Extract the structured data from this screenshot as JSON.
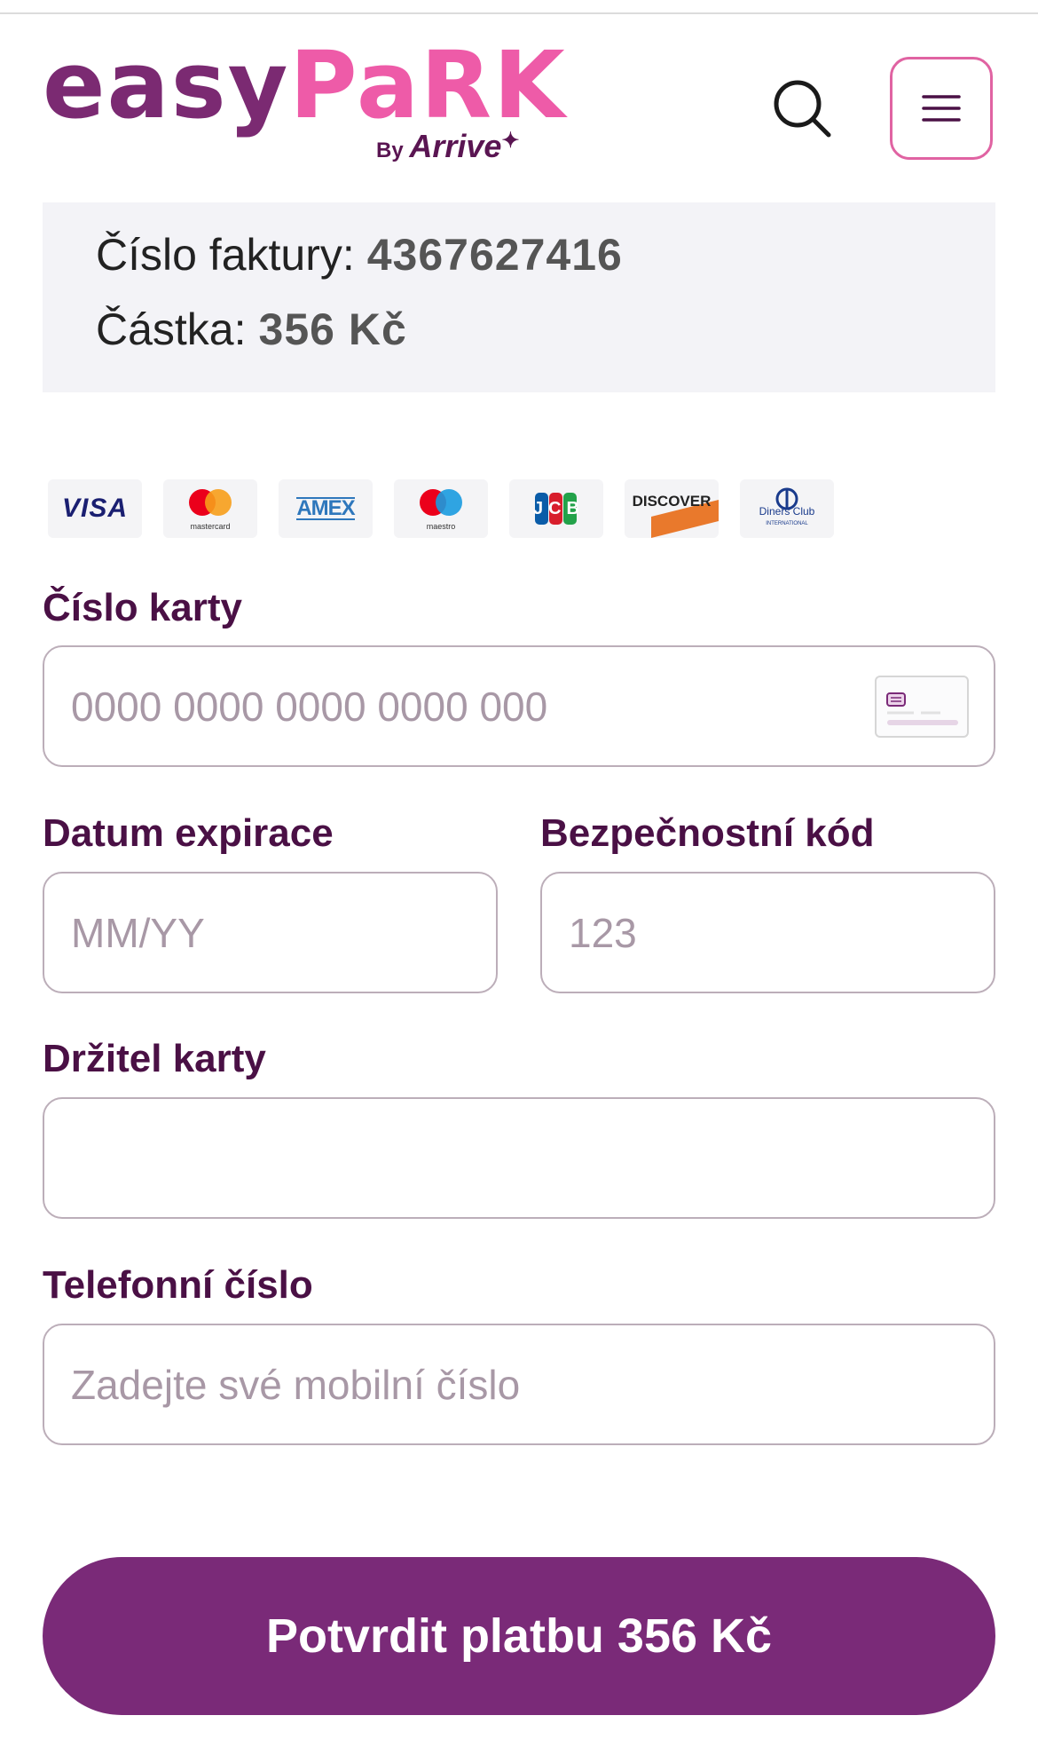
{
  "header": {
    "logo": {
      "easy": "easy",
      "park": "PaRK",
      "by": "By",
      "arrive": "Arrive"
    },
    "search_icon": "search-icon",
    "menu_icon": "hamburger-menu-icon"
  },
  "invoice": {
    "number_label": "Číslo faktury:",
    "number_value": "4367627416",
    "amount_label": "Částka:",
    "amount_value": "356 Kč"
  },
  "card_brands": {
    "visa": "VISA",
    "mastercard": "mastercard",
    "amex": "AMEX",
    "maestro": "maestro",
    "jcb": "JCB",
    "discover": "DISCOVER",
    "diners_line1": "Diners Club",
    "diners_line2": "INTERNATIONAL"
  },
  "form": {
    "card_number": {
      "label": "Číslo karty",
      "placeholder": "0000 0000 0000 0000 000",
      "value": ""
    },
    "expiry": {
      "label": "Datum expirace",
      "placeholder": "MM/YY",
      "value": ""
    },
    "cvc": {
      "label": "Bezpečnostní kód",
      "placeholder": "123",
      "value": ""
    },
    "holder": {
      "label": "Držitel karty",
      "placeholder": "",
      "value": ""
    },
    "phone": {
      "label": "Telefonní číslo",
      "placeholder": "Zadejte své mobilní číslo",
      "value": ""
    }
  },
  "submit": {
    "label": "Potvrdit platbu 356 Kč"
  },
  "colors": {
    "brand_purple": "#7a2a78",
    "brand_pink": "#ee5ba8",
    "label_color": "#4a1045",
    "panel_bg": "#f3f3f7"
  }
}
